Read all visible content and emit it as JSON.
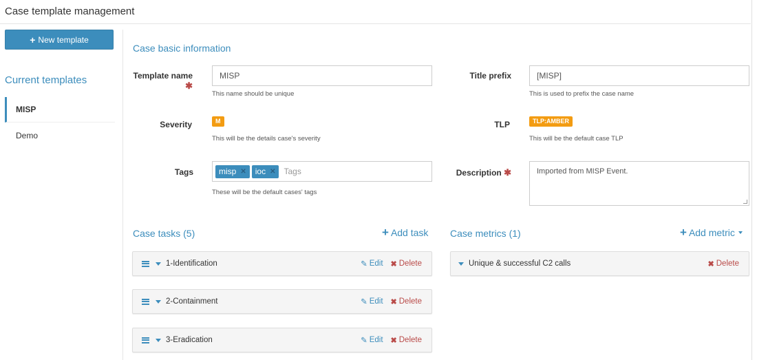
{
  "header": {
    "title": "Case template management"
  },
  "sidebar": {
    "new_button_label": "New template",
    "heading": "Current templates",
    "items": [
      {
        "label": "MISP",
        "active": true
      },
      {
        "label": "Demo",
        "active": false
      }
    ]
  },
  "basic": {
    "title": "Case basic information",
    "template_name": {
      "label": "Template name",
      "value": "MISP",
      "help": "This name should be unique"
    },
    "title_prefix": {
      "label": "Title prefix",
      "value": "[MISP]",
      "help": "This is used to prefix the case name"
    },
    "severity": {
      "label": "Severity",
      "value": "M",
      "help": "This will be the details case's severity"
    },
    "tlp": {
      "label": "TLP",
      "value": "TLP:AMBER",
      "help": "This will be the default case TLP"
    },
    "tags": {
      "label": "Tags",
      "items": [
        "misp",
        "ioc"
      ],
      "placeholder": "Tags",
      "help": "These will be the default cases' tags"
    },
    "description": {
      "label": "Description",
      "value": "Imported from MISP Event."
    },
    "required_mark": "✱",
    "badge_color": "#f39c12"
  },
  "tasks": {
    "title": "Case tasks (5)",
    "add_label": "Add task",
    "items": [
      {
        "name": "1-Identification"
      },
      {
        "name": "2-Containment"
      },
      {
        "name": "3-Eradication"
      }
    ],
    "edit_label": "Edit",
    "delete_label": "Delete"
  },
  "metrics": {
    "title": "Case metrics (1)",
    "add_label": "Add metric",
    "items": [
      {
        "name": "Unique & successful C2 calls"
      }
    ],
    "delete_label": "Delete"
  },
  "colors": {
    "accent": "#3c8dbc",
    "danger": "#b94a48",
    "warning": "#f39c12"
  }
}
